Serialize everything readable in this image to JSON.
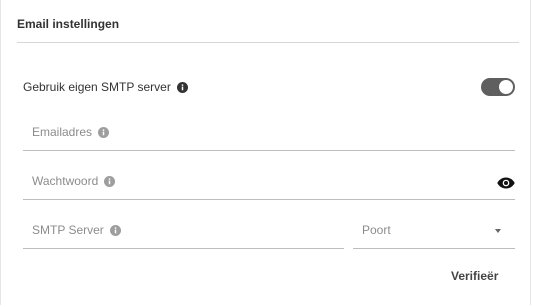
{
  "card": {
    "title": "Email instellingen"
  },
  "smtp_toggle": {
    "label": "Gebruik eigen SMTP server",
    "enabled": true,
    "info_icon": "info-icon",
    "colors": {
      "track": "#5f5f5f",
      "knob": "#ffffff"
    }
  },
  "fields": {
    "email": {
      "label": "Emailadres",
      "value": "",
      "info_icon": "info-icon"
    },
    "password": {
      "label": "Wachtwoord",
      "value": "",
      "info_icon": "info-icon",
      "toggle_icon": "eye-icon"
    },
    "smtp_server": {
      "label": "SMTP Server",
      "value": "",
      "info_icon": "info-icon"
    },
    "port": {
      "label": "Poort",
      "selected": "",
      "dropdown_icon": "caret-down-icon"
    }
  },
  "actions": {
    "verify_label": "Verifieër"
  }
}
